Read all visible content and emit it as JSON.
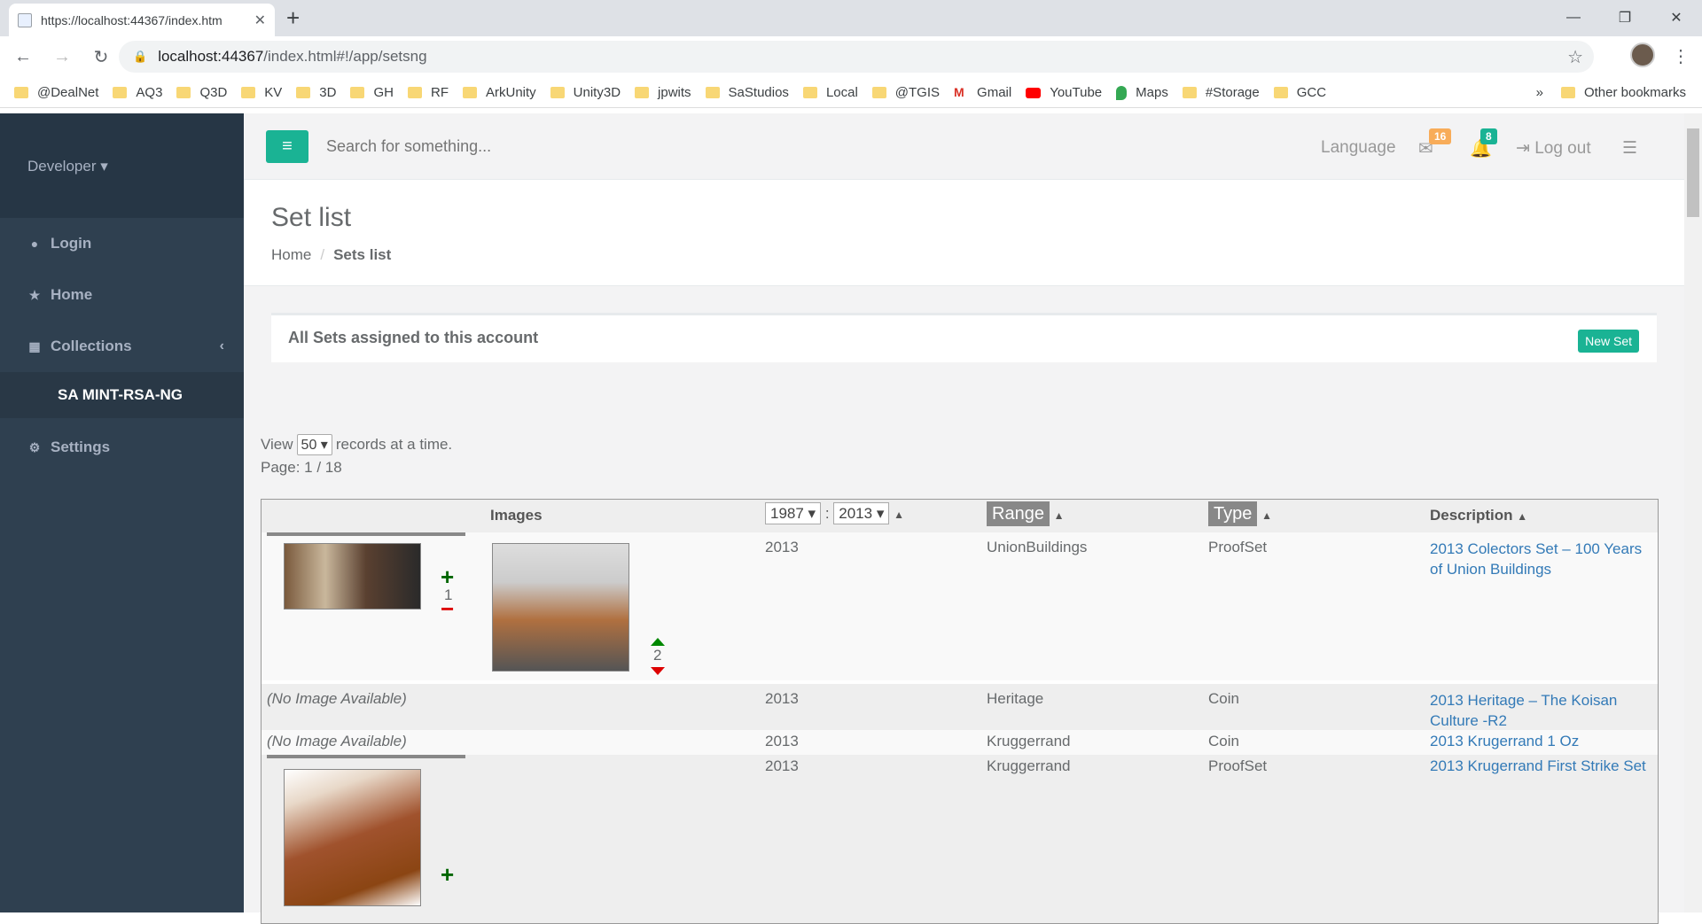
{
  "browser": {
    "tab_title": "https://localhost:44367/index.htm",
    "url_host": "localhost:44367",
    "url_path": "/index.html#!/app/setsng",
    "bookmarks": [
      "@DealNet",
      "AQ3",
      "Q3D",
      "KV",
      "3D",
      "GH",
      "RF",
      "ArkUnity",
      "Unity3D",
      "jpwits",
      "SaStudios",
      "Local",
      "@TGIS",
      "Gmail",
      "YouTube",
      "Maps",
      "#Storage",
      "GCC"
    ],
    "other_bookmarks": "Other bookmarks",
    "more": "»"
  },
  "sidebar": {
    "user": "Developer ▾",
    "items": [
      {
        "label": "Login",
        "icon": "●"
      },
      {
        "label": "Home",
        "icon": "★"
      },
      {
        "label": "Collections",
        "icon": "▦"
      },
      {
        "label": "SA MINT-RSA-NG"
      },
      {
        "label": "Settings",
        "icon": "⚙"
      }
    ]
  },
  "topbar": {
    "search_placeholder": "Search for something...",
    "language": "Language",
    "mail_count": "16",
    "bell_count": "8",
    "logout": "Log out",
    "mail_color": "#f8ac59",
    "bell_color": "#1ab394"
  },
  "page": {
    "title": "Set list",
    "breadcrumb_home": "Home",
    "breadcrumb_current": "Sets list"
  },
  "panel": {
    "title": "All Sets assigned to this account",
    "new_set": "New Set",
    "view_label": "View",
    "page_size": "50",
    "records_label": "records at a time.",
    "page_info": "Page: 1 / 18"
  },
  "table": {
    "headers": {
      "images": "Images",
      "year_from": "1987",
      "year_to": "2013",
      "range": "Range",
      "type": "Type",
      "description": "Description"
    },
    "rows": [
      {
        "year": "2013",
        "range": "UnionBuildings",
        "type": "ProofSet",
        "desc": "2013 Colectors Set – 100 Years of Union Buildings",
        "count1": "1",
        "count2": "2"
      },
      {
        "noimg": "(No Image Available)",
        "year": "2013",
        "range": "Heritage",
        "type": "Coin",
        "desc": "2013 Heritage – The Koisan Culture -R2"
      },
      {
        "noimg": "(No Image Available)",
        "year": "2013",
        "range": "Kruggerrand",
        "type": "Coin",
        "desc": "2013 Krugerrand 1 Oz"
      },
      {
        "year": "2013",
        "range": "Kruggerrand",
        "type": "ProofSet",
        "desc": "2013 Krugerrand First Strike Set"
      }
    ]
  }
}
